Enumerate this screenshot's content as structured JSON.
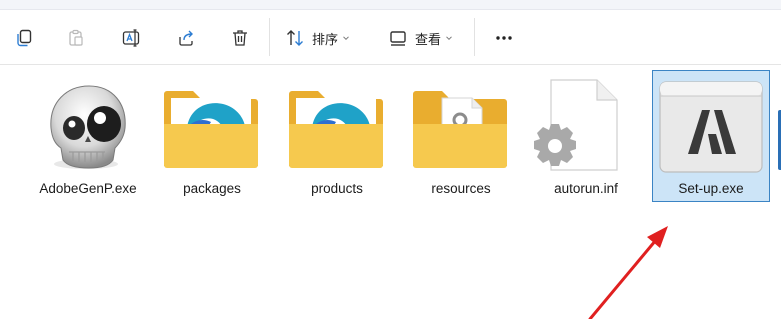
{
  "toolbar": {
    "buttons": [
      {
        "name": "copy-icon"
      },
      {
        "name": "paste-icon"
      },
      {
        "name": "rename-icon"
      },
      {
        "name": "share-icon"
      },
      {
        "name": "delete-icon"
      }
    ],
    "sort_label": "排序",
    "view_label": "查看",
    "more_icon": "more-icon"
  },
  "files": [
    {
      "name": "AdobeGenP.exe",
      "icon": "skull-app-icon"
    },
    {
      "name": "packages",
      "icon": "folder-edge-icon"
    },
    {
      "name": "products",
      "icon": "folder-edge-icon"
    },
    {
      "name": "resources",
      "icon": "folder-document-icon"
    },
    {
      "name": "autorun.inf",
      "icon": "settings-file-icon"
    },
    {
      "name": "Set-up.exe",
      "icon": "adobe-installer-icon",
      "selected": true
    }
  ],
  "colors": {
    "selection_bg": "#cce4f7",
    "selection_border": "#3b84c4",
    "arrow": "#e02020",
    "folder": "#f4c64a"
  }
}
